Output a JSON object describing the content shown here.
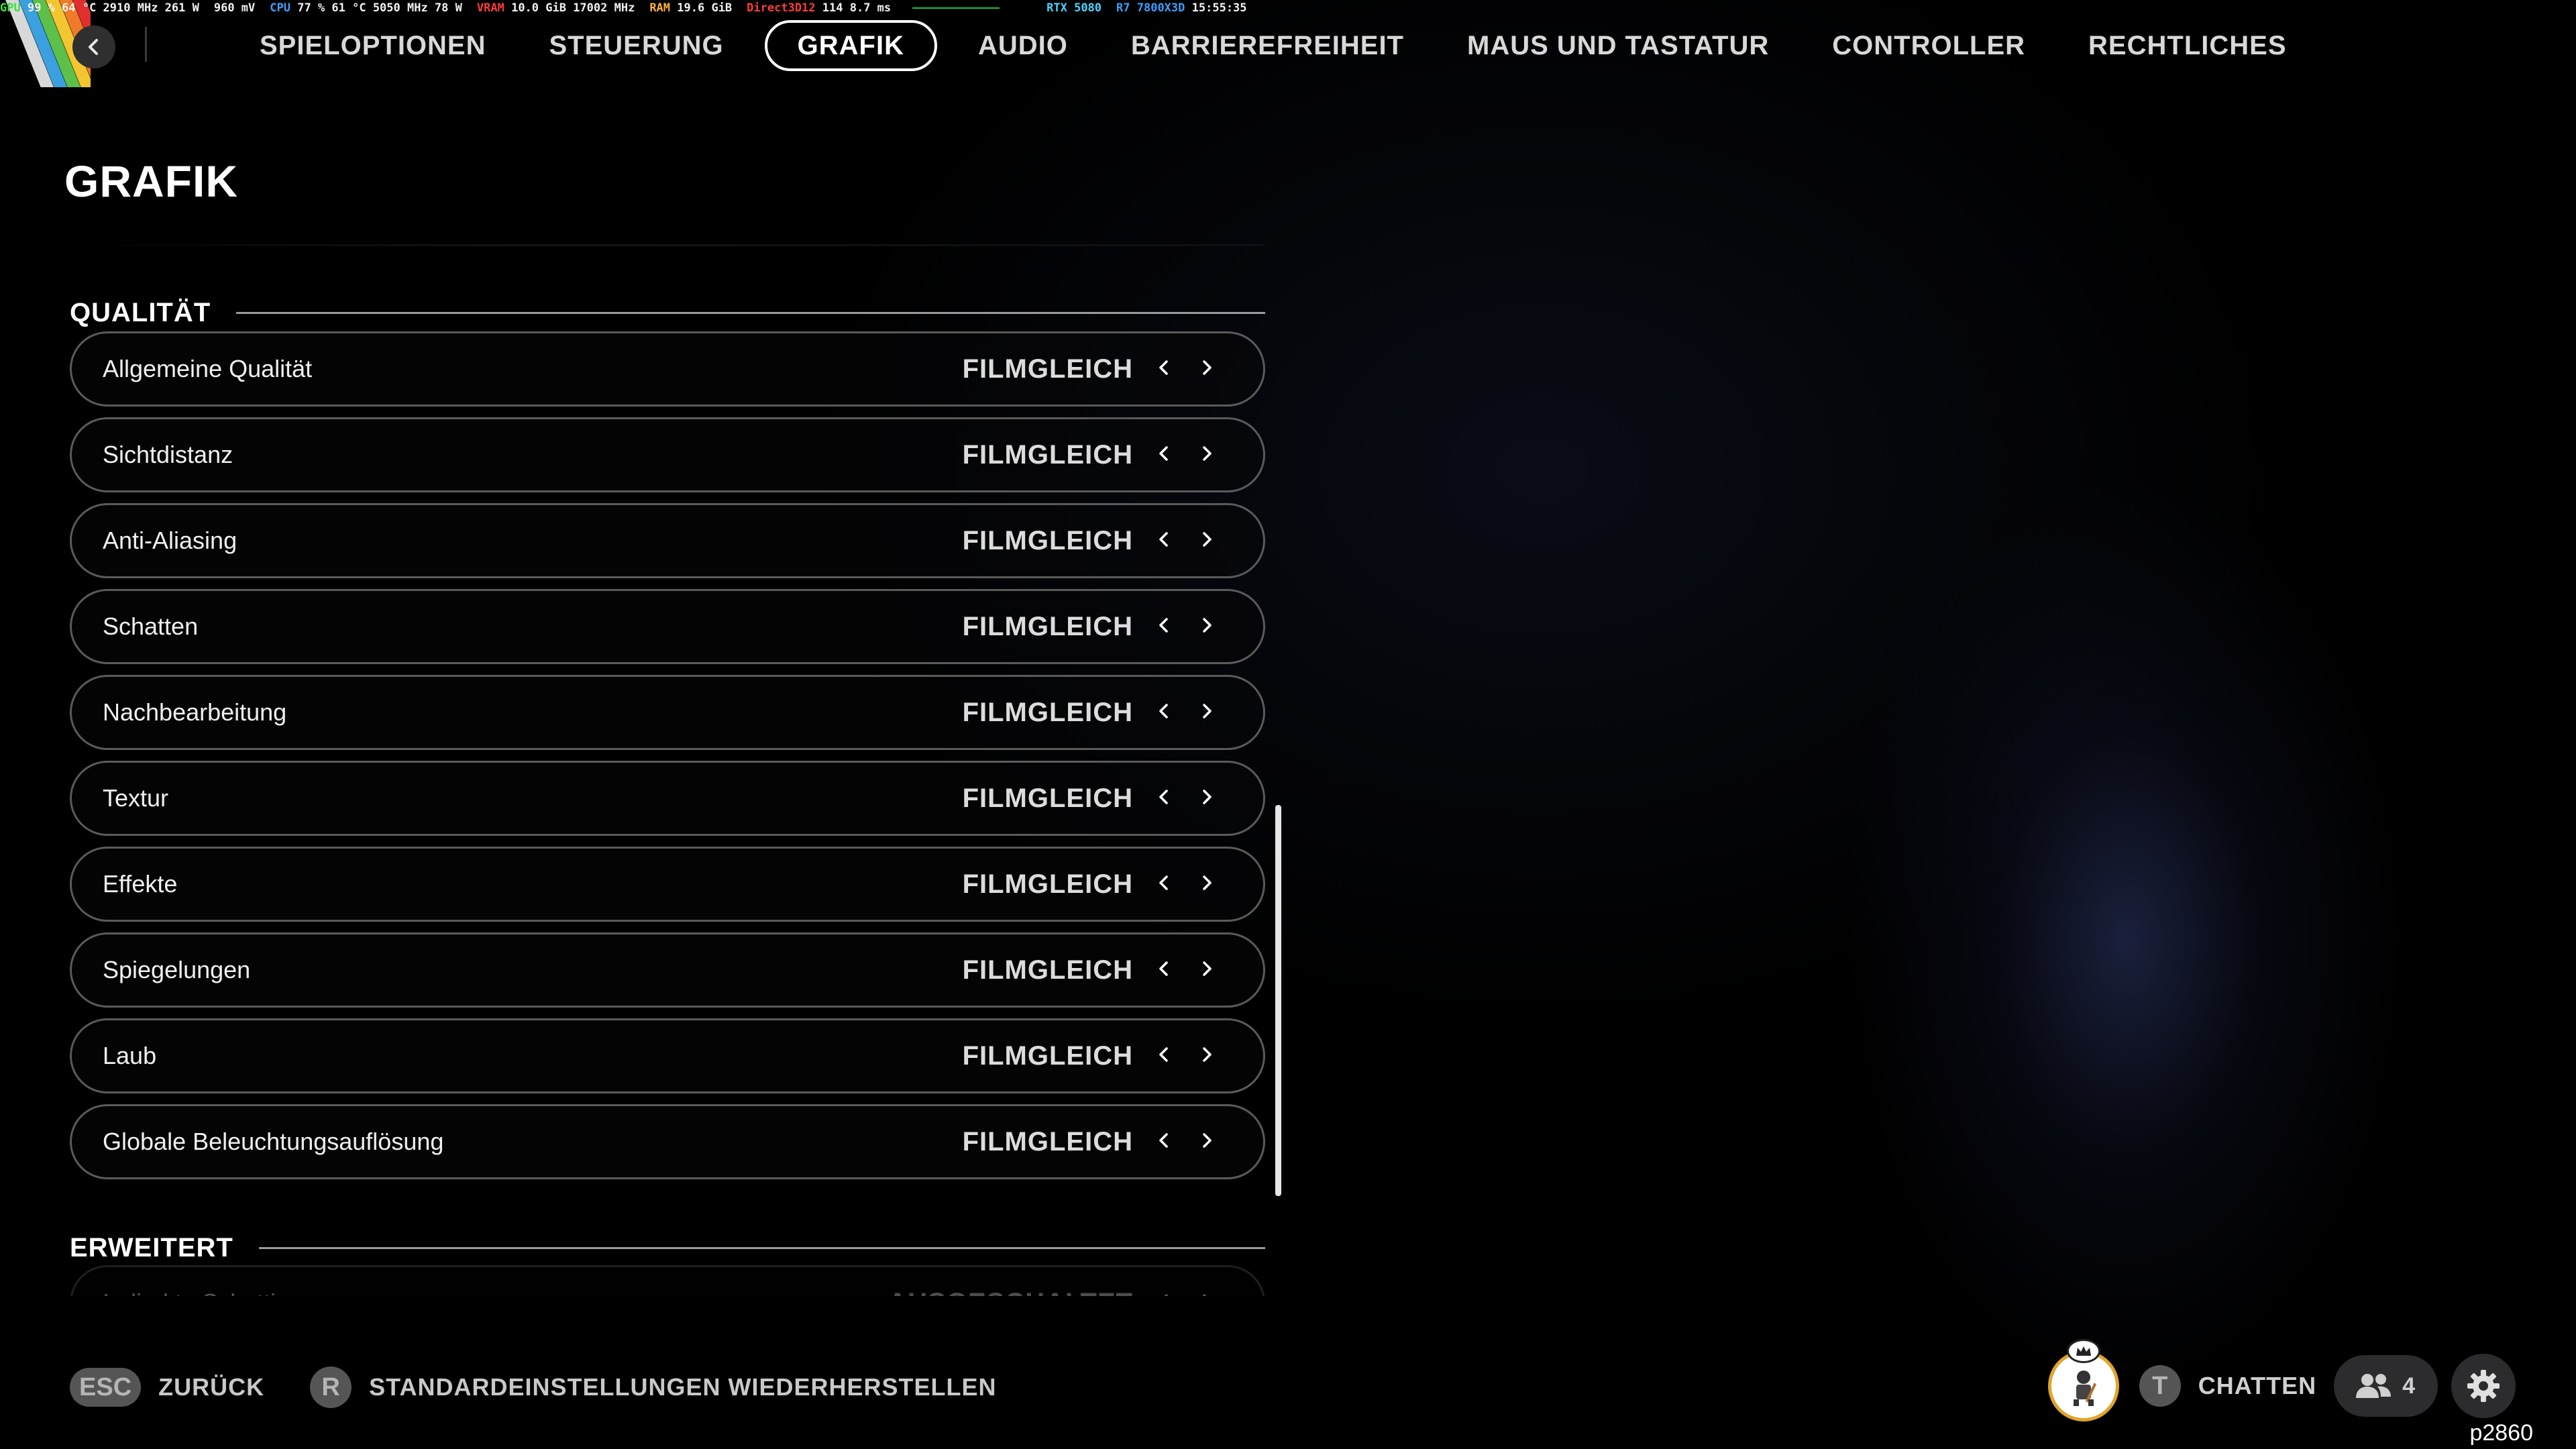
{
  "perf_overlay": {
    "segments": [
      {
        "label": "GPU",
        "label_color": "green",
        "value": "99 % 64 °C 2910 MHz 261 W"
      },
      {
        "label": "",
        "label_color": "green",
        "value": "960 mV"
      },
      {
        "label": "CPU",
        "label_color": "blue",
        "value": "77 % 61 °C 5050 MHz 78 W"
      },
      {
        "label": "VRAM",
        "label_color": "red",
        "value": "10.0 GiB 17002 MHz"
      },
      {
        "label": "RAM",
        "label_color": "orange",
        "value": "19.6 GiB"
      },
      {
        "label": "Direct3D12",
        "label_color": "red",
        "value": "114 8.7 ms"
      },
      {
        "label": "RTX 5080",
        "label_color": "cyan",
        "value": ""
      },
      {
        "label": "R7 7800X3D",
        "label_color": "blue",
        "value": "15:55:35"
      }
    ]
  },
  "nav": {
    "tabs": [
      {
        "label": "SPIELOPTIONEN",
        "active": false
      },
      {
        "label": "STEUERUNG",
        "active": false
      },
      {
        "label": "GRAFIK",
        "active": true
      },
      {
        "label": "AUDIO",
        "active": false
      },
      {
        "label": "BARRIEREFREIHEIT",
        "active": false
      },
      {
        "label": "MAUS UND TASTATUR",
        "active": false
      },
      {
        "label": "CONTROLLER",
        "active": false
      },
      {
        "label": "RECHTLICHES",
        "active": false
      }
    ]
  },
  "page": {
    "title": "GRAFIK"
  },
  "sections": {
    "quality": {
      "header": "QUALITÄT",
      "rows": [
        {
          "label": "Allgemeine Qualität",
          "value": "FILMGLEICH"
        },
        {
          "label": "Sichtdistanz",
          "value": "FILMGLEICH"
        },
        {
          "label": "Anti-Aliasing",
          "value": "FILMGLEICH"
        },
        {
          "label": "Schatten",
          "value": "FILMGLEICH"
        },
        {
          "label": "Nachbearbeitung",
          "value": "FILMGLEICH"
        },
        {
          "label": "Textur",
          "value": "FILMGLEICH"
        },
        {
          "label": "Effekte",
          "value": "FILMGLEICH"
        },
        {
          "label": "Spiegelungen",
          "value": "FILMGLEICH"
        },
        {
          "label": "Laub",
          "value": "FILMGLEICH"
        },
        {
          "label": "Globale Beleuchtungsauflösung",
          "value": "FILMGLEICH"
        }
      ]
    },
    "advanced": {
      "header": "ERWEITERT",
      "rows": [
        {
          "label": "Indirekte Schattierung",
          "value": "AUSGESCHALTET"
        }
      ]
    }
  },
  "bottom_bar": {
    "back_key": "ESC",
    "back_label": "ZURÜCK",
    "reset_key": "R",
    "reset_label": "STANDARDEINSTELLUNGEN WIEDERHERSTELLEN",
    "chat_key": "T",
    "chat_label": "CHATTEN",
    "friends_count": "4",
    "corner_code": "p2860"
  },
  "colors": {
    "background": "#000000",
    "row_border": "#5a5a5a",
    "accent_avatar_ring": "#e0a52a"
  },
  "icons": {
    "back": "chevron-left-icon",
    "prev": "chevron-left-icon",
    "next": "chevron-right-icon",
    "friends": "people-icon",
    "settings": "gear-icon"
  }
}
